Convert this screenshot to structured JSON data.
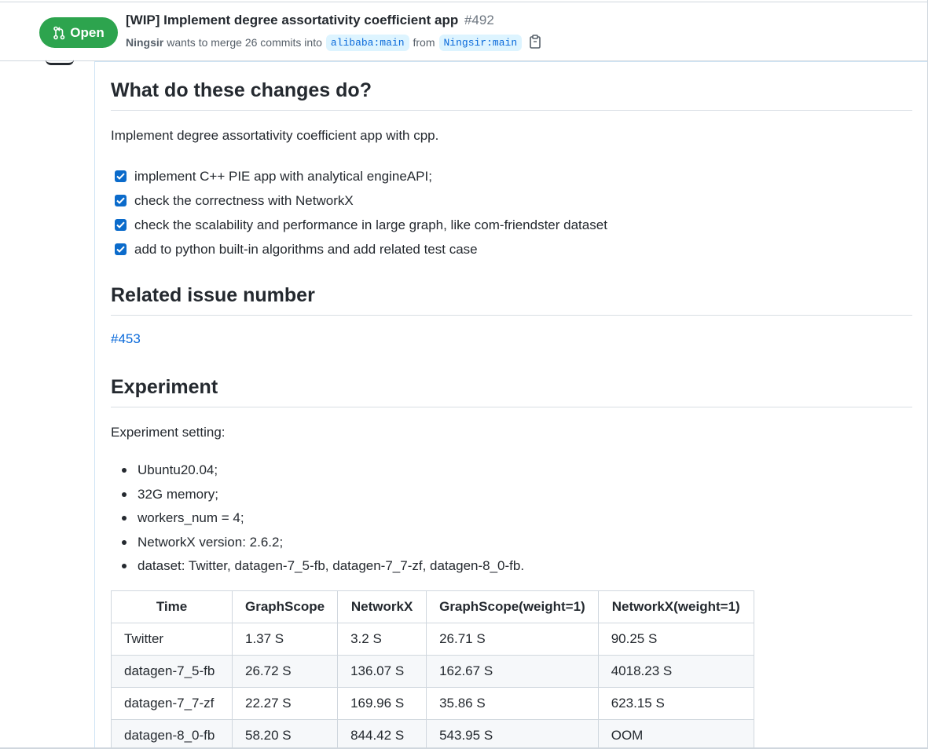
{
  "pr": {
    "state": "Open",
    "title": "[WIP] Implement degree assortativity coefficient app",
    "number": "#492",
    "author": "Ningsir",
    "merge_text": "wants to merge 26 commits into",
    "base_branch": "alibaba:main",
    "from_text": "from",
    "head_branch": "Ningsir:main",
    "state_color": "#2da44e"
  },
  "body": {
    "section1_heading": "What do these changes do?",
    "summary": "Implement degree assortativity coefficient app with cpp.",
    "tasks": [
      "implement C++ PIE app with analytical engineAPI;",
      "check the correctness with NetworkX",
      "check the scalability and performance in large graph, like com-friendster dataset",
      "add to python built-in algorithms and add related test case"
    ],
    "section2_heading": "Related issue number",
    "issue_link": "#453",
    "section3_heading": "Experiment",
    "setting_label": "Experiment setting:",
    "settings": [
      "Ubuntu20.04;",
      "32G memory;",
      "workers_num = 4;",
      "NetworkX version: 2.6.2;",
      "dataset: Twitter, datagen-7_5-fb, datagen-7_7-zf, datagen-8_0-fb."
    ],
    "table": {
      "headers": [
        "Time",
        "GraphScope",
        "NetworkX",
        "GraphScope(weight=1)",
        "NetworkX(weight=1)"
      ],
      "rows": [
        [
          "Twitter",
          "1.37 S",
          "3.2 S",
          "26.71 S",
          "90.25 S"
        ],
        [
          "datagen-7_5-fb",
          "26.72 S",
          "136.07 S",
          "162.67 S",
          "4018.23 S"
        ],
        [
          "datagen-7_7-zf",
          "22.27 S",
          "169.96 S",
          "35.86 S",
          "623.15 S"
        ],
        [
          "datagen-8_0-fb",
          "58.20 S",
          "844.42 S",
          "543.95 S",
          "OOM"
        ]
      ]
    }
  },
  "icons": {
    "state": "git-pull-request-icon",
    "copy": "copy-icon",
    "checkbox": "checkbox-checked-icon"
  }
}
